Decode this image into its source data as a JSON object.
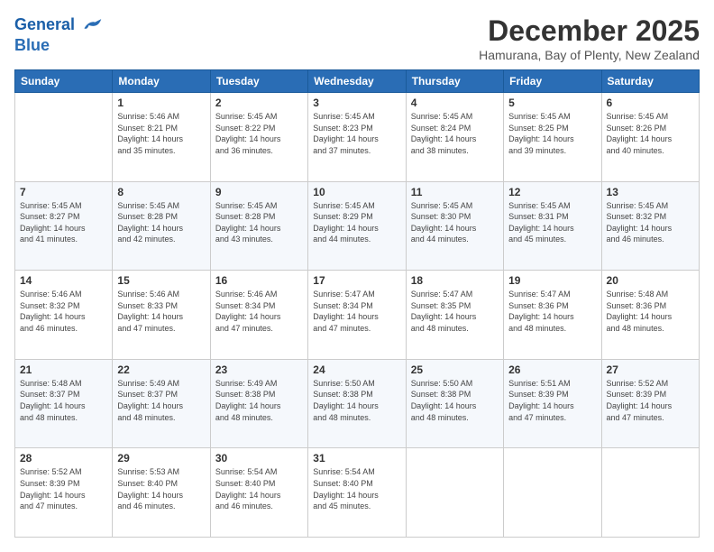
{
  "header": {
    "logo_line1": "General",
    "logo_line2": "Blue",
    "title": "December 2025",
    "subtitle": "Hamurana, Bay of Plenty, New Zealand"
  },
  "days_of_week": [
    "Sunday",
    "Monday",
    "Tuesday",
    "Wednesday",
    "Thursday",
    "Friday",
    "Saturday"
  ],
  "weeks": [
    [
      {
        "day": "",
        "content": ""
      },
      {
        "day": "1",
        "content": "Sunrise: 5:46 AM\nSunset: 8:21 PM\nDaylight: 14 hours\nand 35 minutes."
      },
      {
        "day": "2",
        "content": "Sunrise: 5:45 AM\nSunset: 8:22 PM\nDaylight: 14 hours\nand 36 minutes."
      },
      {
        "day": "3",
        "content": "Sunrise: 5:45 AM\nSunset: 8:23 PM\nDaylight: 14 hours\nand 37 minutes."
      },
      {
        "day": "4",
        "content": "Sunrise: 5:45 AM\nSunset: 8:24 PM\nDaylight: 14 hours\nand 38 minutes."
      },
      {
        "day": "5",
        "content": "Sunrise: 5:45 AM\nSunset: 8:25 PM\nDaylight: 14 hours\nand 39 minutes."
      },
      {
        "day": "6",
        "content": "Sunrise: 5:45 AM\nSunset: 8:26 PM\nDaylight: 14 hours\nand 40 minutes."
      }
    ],
    [
      {
        "day": "7",
        "content": "Sunrise: 5:45 AM\nSunset: 8:27 PM\nDaylight: 14 hours\nand 41 minutes."
      },
      {
        "day": "8",
        "content": "Sunrise: 5:45 AM\nSunset: 8:28 PM\nDaylight: 14 hours\nand 42 minutes."
      },
      {
        "day": "9",
        "content": "Sunrise: 5:45 AM\nSunset: 8:28 PM\nDaylight: 14 hours\nand 43 minutes."
      },
      {
        "day": "10",
        "content": "Sunrise: 5:45 AM\nSunset: 8:29 PM\nDaylight: 14 hours\nand 44 minutes."
      },
      {
        "day": "11",
        "content": "Sunrise: 5:45 AM\nSunset: 8:30 PM\nDaylight: 14 hours\nand 44 minutes."
      },
      {
        "day": "12",
        "content": "Sunrise: 5:45 AM\nSunset: 8:31 PM\nDaylight: 14 hours\nand 45 minutes."
      },
      {
        "day": "13",
        "content": "Sunrise: 5:45 AM\nSunset: 8:32 PM\nDaylight: 14 hours\nand 46 minutes."
      }
    ],
    [
      {
        "day": "14",
        "content": "Sunrise: 5:46 AM\nSunset: 8:32 PM\nDaylight: 14 hours\nand 46 minutes."
      },
      {
        "day": "15",
        "content": "Sunrise: 5:46 AM\nSunset: 8:33 PM\nDaylight: 14 hours\nand 47 minutes."
      },
      {
        "day": "16",
        "content": "Sunrise: 5:46 AM\nSunset: 8:34 PM\nDaylight: 14 hours\nand 47 minutes."
      },
      {
        "day": "17",
        "content": "Sunrise: 5:47 AM\nSunset: 8:34 PM\nDaylight: 14 hours\nand 47 minutes."
      },
      {
        "day": "18",
        "content": "Sunrise: 5:47 AM\nSunset: 8:35 PM\nDaylight: 14 hours\nand 48 minutes."
      },
      {
        "day": "19",
        "content": "Sunrise: 5:47 AM\nSunset: 8:36 PM\nDaylight: 14 hours\nand 48 minutes."
      },
      {
        "day": "20",
        "content": "Sunrise: 5:48 AM\nSunset: 8:36 PM\nDaylight: 14 hours\nand 48 minutes."
      }
    ],
    [
      {
        "day": "21",
        "content": "Sunrise: 5:48 AM\nSunset: 8:37 PM\nDaylight: 14 hours\nand 48 minutes."
      },
      {
        "day": "22",
        "content": "Sunrise: 5:49 AM\nSunset: 8:37 PM\nDaylight: 14 hours\nand 48 minutes."
      },
      {
        "day": "23",
        "content": "Sunrise: 5:49 AM\nSunset: 8:38 PM\nDaylight: 14 hours\nand 48 minutes."
      },
      {
        "day": "24",
        "content": "Sunrise: 5:50 AM\nSunset: 8:38 PM\nDaylight: 14 hours\nand 48 minutes."
      },
      {
        "day": "25",
        "content": "Sunrise: 5:50 AM\nSunset: 8:38 PM\nDaylight: 14 hours\nand 48 minutes."
      },
      {
        "day": "26",
        "content": "Sunrise: 5:51 AM\nSunset: 8:39 PM\nDaylight: 14 hours\nand 47 minutes."
      },
      {
        "day": "27",
        "content": "Sunrise: 5:52 AM\nSunset: 8:39 PM\nDaylight: 14 hours\nand 47 minutes."
      }
    ],
    [
      {
        "day": "28",
        "content": "Sunrise: 5:52 AM\nSunset: 8:39 PM\nDaylight: 14 hours\nand 47 minutes."
      },
      {
        "day": "29",
        "content": "Sunrise: 5:53 AM\nSunset: 8:40 PM\nDaylight: 14 hours\nand 46 minutes."
      },
      {
        "day": "30",
        "content": "Sunrise: 5:54 AM\nSunset: 8:40 PM\nDaylight: 14 hours\nand 46 minutes."
      },
      {
        "day": "31",
        "content": "Sunrise: 5:54 AM\nSunset: 8:40 PM\nDaylight: 14 hours\nand 45 minutes."
      },
      {
        "day": "",
        "content": ""
      },
      {
        "day": "",
        "content": ""
      },
      {
        "day": "",
        "content": ""
      }
    ]
  ]
}
